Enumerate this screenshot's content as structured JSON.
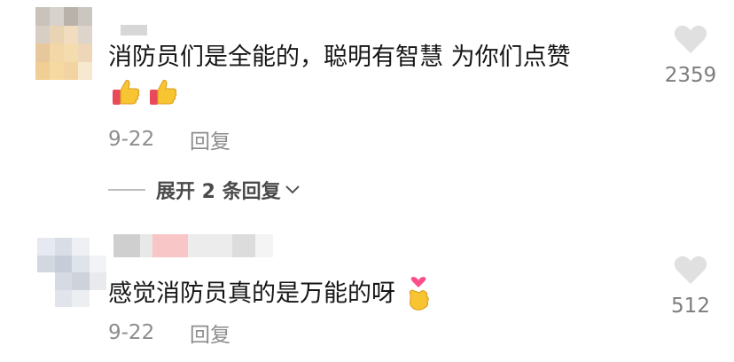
{
  "comments": [
    {
      "text": "消防员们是全能的，聪明有智慧 为你们点赞",
      "emojis": [
        "thumbs-up",
        "thumbs-up"
      ],
      "date": "9-22",
      "reply_label": "回复",
      "likes": "2359",
      "expand_label": "展开 2 条回复"
    },
    {
      "text": "感觉消防员真的是万能的呀",
      "emoji": "finger-heart",
      "date": "9-22",
      "reply_label": "回复",
      "likes": "512"
    }
  ],
  "colors": {
    "like_icon": "#e0e0e0",
    "meta_text": "#8d8d8d",
    "thumb_yellow": "#f7c531",
    "thumb_red": "#e84a5a",
    "heart_pink": "#ff4f8b"
  },
  "icons": [
    "heart-outline-icon",
    "chevron-down-icon",
    "thumbs-up-emoji",
    "finger-heart-emoji"
  ]
}
